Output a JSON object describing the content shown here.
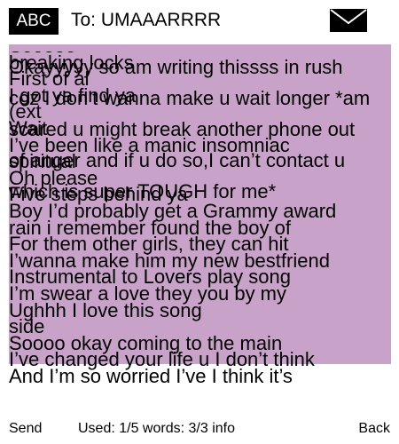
{
  "header": {
    "input_mode": "ABC",
    "recipient": "To: UMAAARRRR",
    "icon": "envelope-icon"
  },
  "message": {
    "intro": "Okayyyyy so am writing thissss in rush coz I don’t wanna make u wait longer *am scared u might break another phone out of anger and if u do so,I can’t contact u which is super TOUGH for me*",
    "overlapping_lines": [
      "Sooooo",
      "breaking locks",
      "First of al",
      "I got ya find ya",
      "(ext",
      "Wait",
      "I’ve been like a manic insomniac",
      "spiritual",
      "Oh please",
      "Five steps behind ya",
      "Boy I’d probably get a Grammy award",
      "rain i remember found the boy of",
      "For them other girls, they can hit",
      "I’wanna make him my new bestfriend",
      "Instrumental to Lovers play song",
      "I’m swear a love they you by my",
      "Ughhh I love this song",
      "side",
      "Soooo okay coming to the main",
      "I’ve changed your life u I don’t think",
      "And I’m so worried I’ve I think it’s"
    ]
  },
  "footer": {
    "send_label": "Send",
    "info": "Used: 1/5 words: 3/3 info",
    "back_label": "Back"
  },
  "colors": {
    "message_background": "#c8a2c8",
    "badge_background": "#000000"
  }
}
